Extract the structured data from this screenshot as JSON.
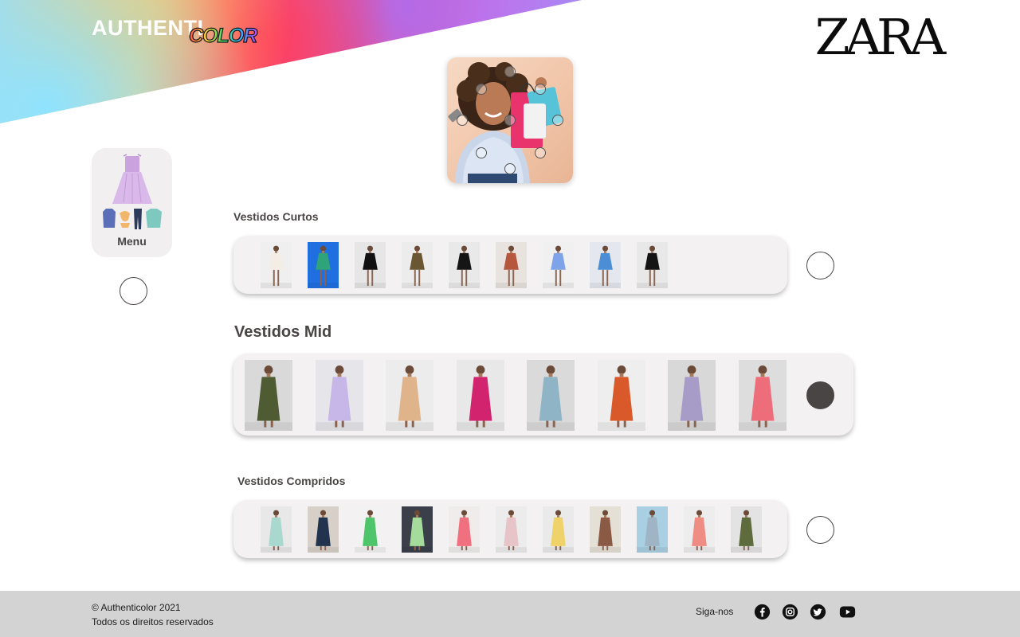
{
  "header": {
    "logo_part1": "AUTHENTI",
    "logo_part2": "COLOR",
    "partner_logo": "ZARA"
  },
  "hero": {
    "icon": "shopping-woman-photo",
    "hotspot_count": 10
  },
  "menu": {
    "label": "Menu",
    "icon": "clothing-menu-icon"
  },
  "sections": [
    {
      "title": "Vestidos Curtos",
      "items": [
        {
          "bg": "#efefef",
          "color": "#f3ede6"
        },
        {
          "bg": "#1f6fe0",
          "color": "#2fa37a"
        },
        {
          "bg": "#e6e6e6",
          "color": "#111111"
        },
        {
          "bg": "#ececec",
          "color": "#6b5634"
        },
        {
          "bg": "#e9e9e9",
          "color": "#151515"
        },
        {
          "bg": "#e8e3df",
          "color": "#b5563d"
        },
        {
          "bg": "#f0f0f0",
          "color": "#7fa3e8"
        },
        {
          "bg": "#e4e8ee",
          "color": "#4b8ed6"
        },
        {
          "bg": "#e8e8e8",
          "color": "#141414"
        }
      ],
      "selected": false
    },
    {
      "title": "Vestidos Mid",
      "items": [
        {
          "bg": "#d9d9d9",
          "color": "#4f5b33"
        },
        {
          "bg": "#e6e6ea",
          "color": "#c7b6e8"
        },
        {
          "bg": "#ececec",
          "color": "#e0b48a"
        },
        {
          "bg": "#e8e8e8",
          "color": "#d2236f"
        },
        {
          "bg": "#dadada",
          "color": "#8fb4c6"
        },
        {
          "bg": "#eeeeee",
          "color": "#d9592a"
        },
        {
          "bg": "#d8d8d8",
          "color": "#a79cc8"
        },
        {
          "bg": "#dddddd",
          "color": "#ee6d7a"
        }
      ],
      "selected": true
    },
    {
      "title": "Vestidos Compridos",
      "items": [
        {
          "bg": "#e8e8e8",
          "color": "#a9d8cf"
        },
        {
          "bg": "#d6d0c8",
          "color": "#22344d"
        },
        {
          "bg": "#f2f2f2",
          "color": "#4fc56b"
        },
        {
          "bg": "#3a3f4a",
          "color": "#a6dc9b"
        },
        {
          "bg": "#f0ecec",
          "color": "#f07080"
        },
        {
          "bg": "#ececec",
          "color": "#e7c4c8"
        },
        {
          "bg": "#eaeaea",
          "color": "#efd36a"
        },
        {
          "bg": "#e4e0d6",
          "color": "#8b5a44"
        },
        {
          "bg": "#a8cfe2",
          "color": "#9fb4c4"
        },
        {
          "bg": "#ededed",
          "color": "#ef8d84"
        },
        {
          "bg": "#e3e3e3",
          "color": "#5e6b3d"
        }
      ],
      "selected": false
    }
  ],
  "footer": {
    "copyright": "© Authenticolor 2021",
    "rights": "Todos os direitos reservados",
    "follow_label": "Siga-nos",
    "social": [
      "facebook-icon",
      "instagram-icon",
      "twitter-icon",
      "youtube-icon"
    ]
  }
}
